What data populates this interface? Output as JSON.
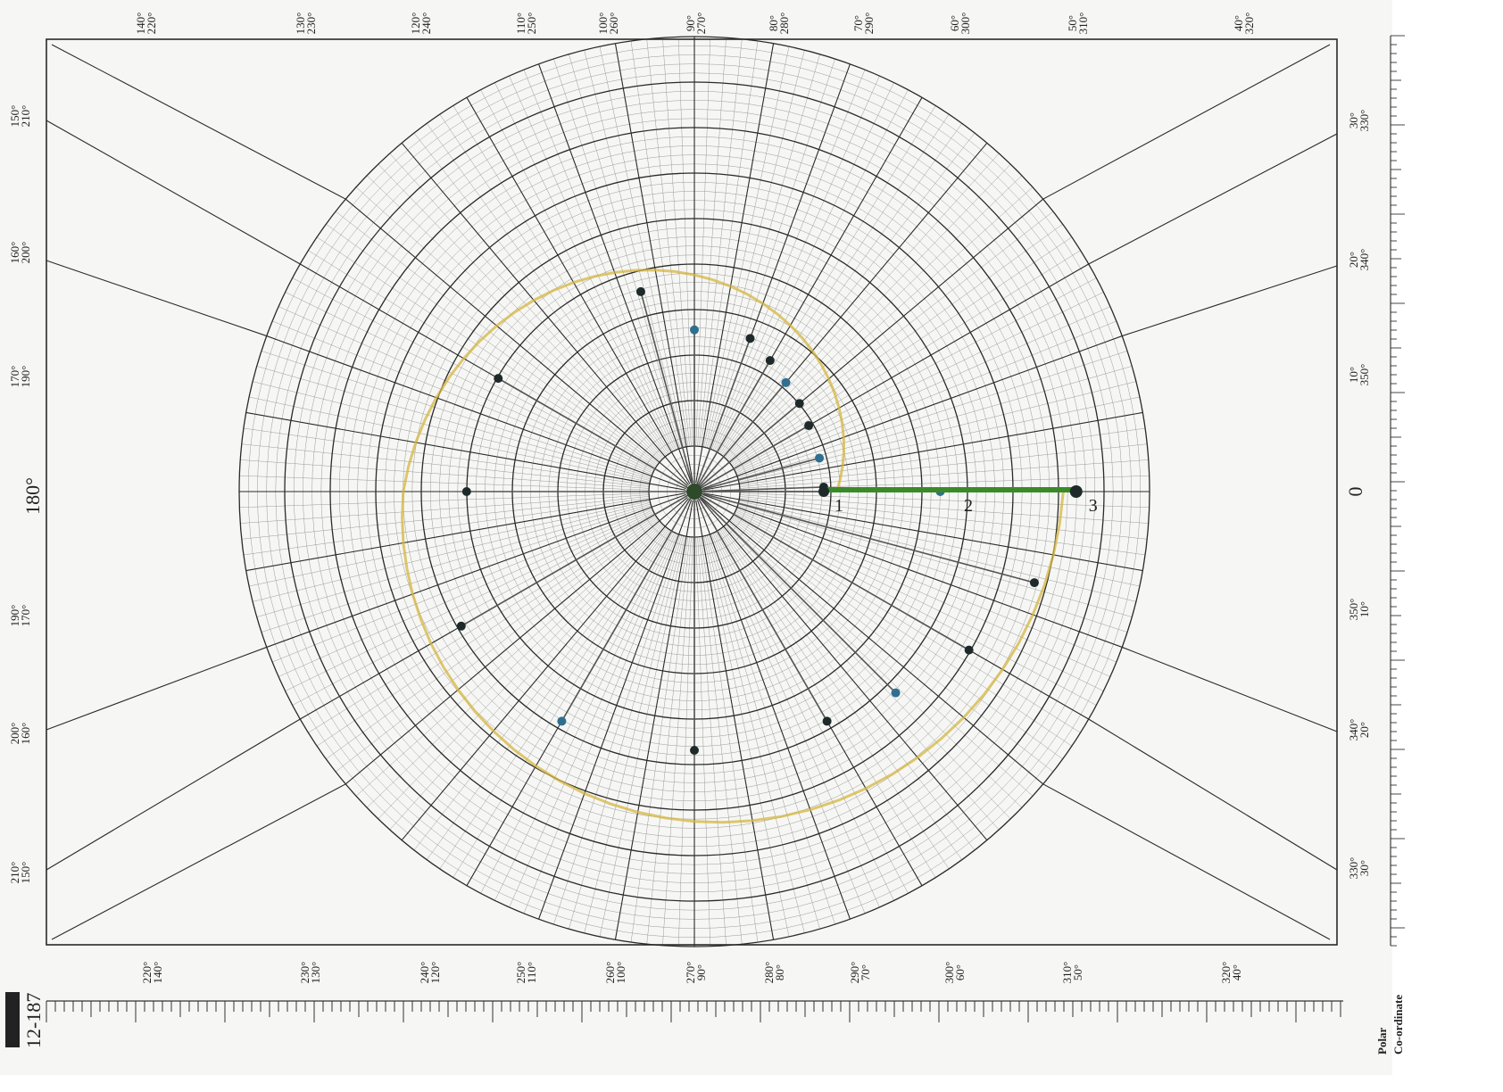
{
  "sheet": {
    "center_label_left": "180°",
    "center_label_right": "0",
    "form_number": "12-187",
    "title_line1": "Polar",
    "title_line2": "Co-ordinate",
    "ring_number_labels": [
      "1",
      "2",
      "3"
    ],
    "top_labels": [
      [
        "140°",
        "220°"
      ],
      [
        "130°",
        "230°"
      ],
      [
        "120°",
        "240°"
      ],
      [
        "110°",
        "250°"
      ],
      [
        "100°",
        "260°"
      ],
      [
        "90°",
        "270°"
      ],
      [
        "80°",
        "280°"
      ],
      [
        "70°",
        "290°"
      ],
      [
        "60°",
        "300°"
      ],
      [
        "50°",
        "310°"
      ],
      [
        "40°",
        "320°"
      ]
    ],
    "bottom_labels": [
      [
        "220°",
        "140°"
      ],
      [
        "230°",
        "130°"
      ],
      [
        "240°",
        "120°"
      ],
      [
        "250°",
        "110°"
      ],
      [
        "260°",
        "100°"
      ],
      [
        "270°",
        "90°"
      ],
      [
        "280°",
        "80°"
      ],
      [
        "290°",
        "70°"
      ],
      [
        "300°",
        "60°"
      ],
      [
        "310°",
        "50°"
      ],
      [
        "320°",
        "40°"
      ]
    ],
    "left_labels": [
      [
        "150°",
        "210°"
      ],
      [
        "160°",
        "200°"
      ],
      [
        "170°",
        "190°"
      ],
      [
        "190°",
        "170°"
      ],
      [
        "200°",
        "160°"
      ],
      [
        "210°",
        "150°"
      ]
    ],
    "right_labels": [
      [
        "30°",
        "330°"
      ],
      [
        "20°",
        "340°"
      ],
      [
        "10°",
        "350°"
      ],
      [
        "350°",
        "10°"
      ],
      [
        "340°",
        "20°"
      ],
      [
        "330°",
        "30°"
      ]
    ]
  },
  "plot": {
    "colors": {
      "grid_fine": "#9a9a9a",
      "grid_major": "#2a2a2a",
      "curve": "#d4b640",
      "spoke": "#555555",
      "green_segment": "#3a8a2a",
      "dot": "#1e2a2a",
      "dot_blue": "#2f6f8f"
    }
  }
}
